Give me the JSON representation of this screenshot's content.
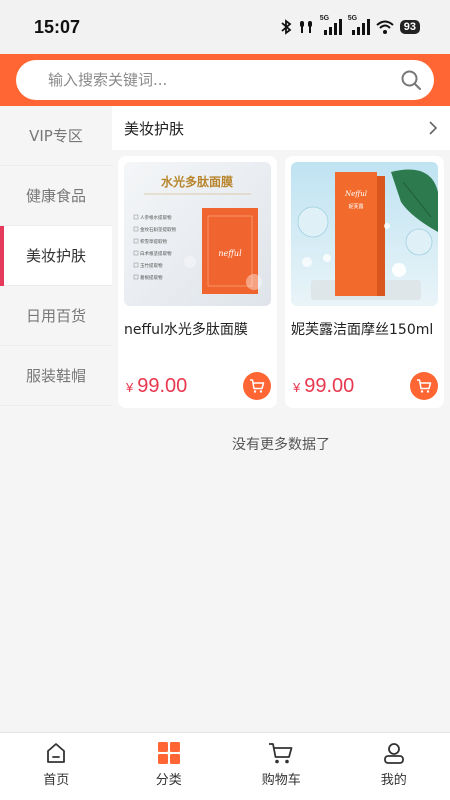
{
  "status": {
    "time": "15:07",
    "battery": "93",
    "net1": "5G",
    "net2": "5G"
  },
  "search": {
    "placeholder": "输入搜索关键词..."
  },
  "sidebar": {
    "items": [
      {
        "label": "VIP专区"
      },
      {
        "label": "健康食品"
      },
      {
        "label": "美妆护肤",
        "active": true
      },
      {
        "label": "日用百货"
      },
      {
        "label": "服装鞋帽"
      }
    ]
  },
  "category": {
    "title": "美妆护肤"
  },
  "products": [
    {
      "name": "nefful水光多肽面膜",
      "price_symbol": "¥",
      "price": "99.00",
      "image_title": "水光多肽面膜",
      "image_brand": "nefful",
      "image_list": [
        "人参根水提取物",
        "金纹石斛茎提取物",
        "积雪草提取物",
        "白术根茎提取物",
        "玉竹提取物",
        "葛根提取物"
      ]
    },
    {
      "name": "妮芙露洁面摩丝150ml",
      "price_symbol": "¥",
      "price": "99.00",
      "image_brand": "Nefful",
      "image_box_text": "妮芙露"
    }
  ],
  "no_more": "没有更多数据了",
  "tabs": [
    {
      "label": "首页",
      "icon": "home-icon"
    },
    {
      "label": "分类",
      "icon": "category-icon",
      "active": true
    },
    {
      "label": "购物车",
      "icon": "cart-icon"
    },
    {
      "label": "我的",
      "icon": "user-icon"
    }
  ],
  "colors": {
    "accent": "#ff6633",
    "price": "#e8384f",
    "sidebar_active": "#e63a5c"
  }
}
